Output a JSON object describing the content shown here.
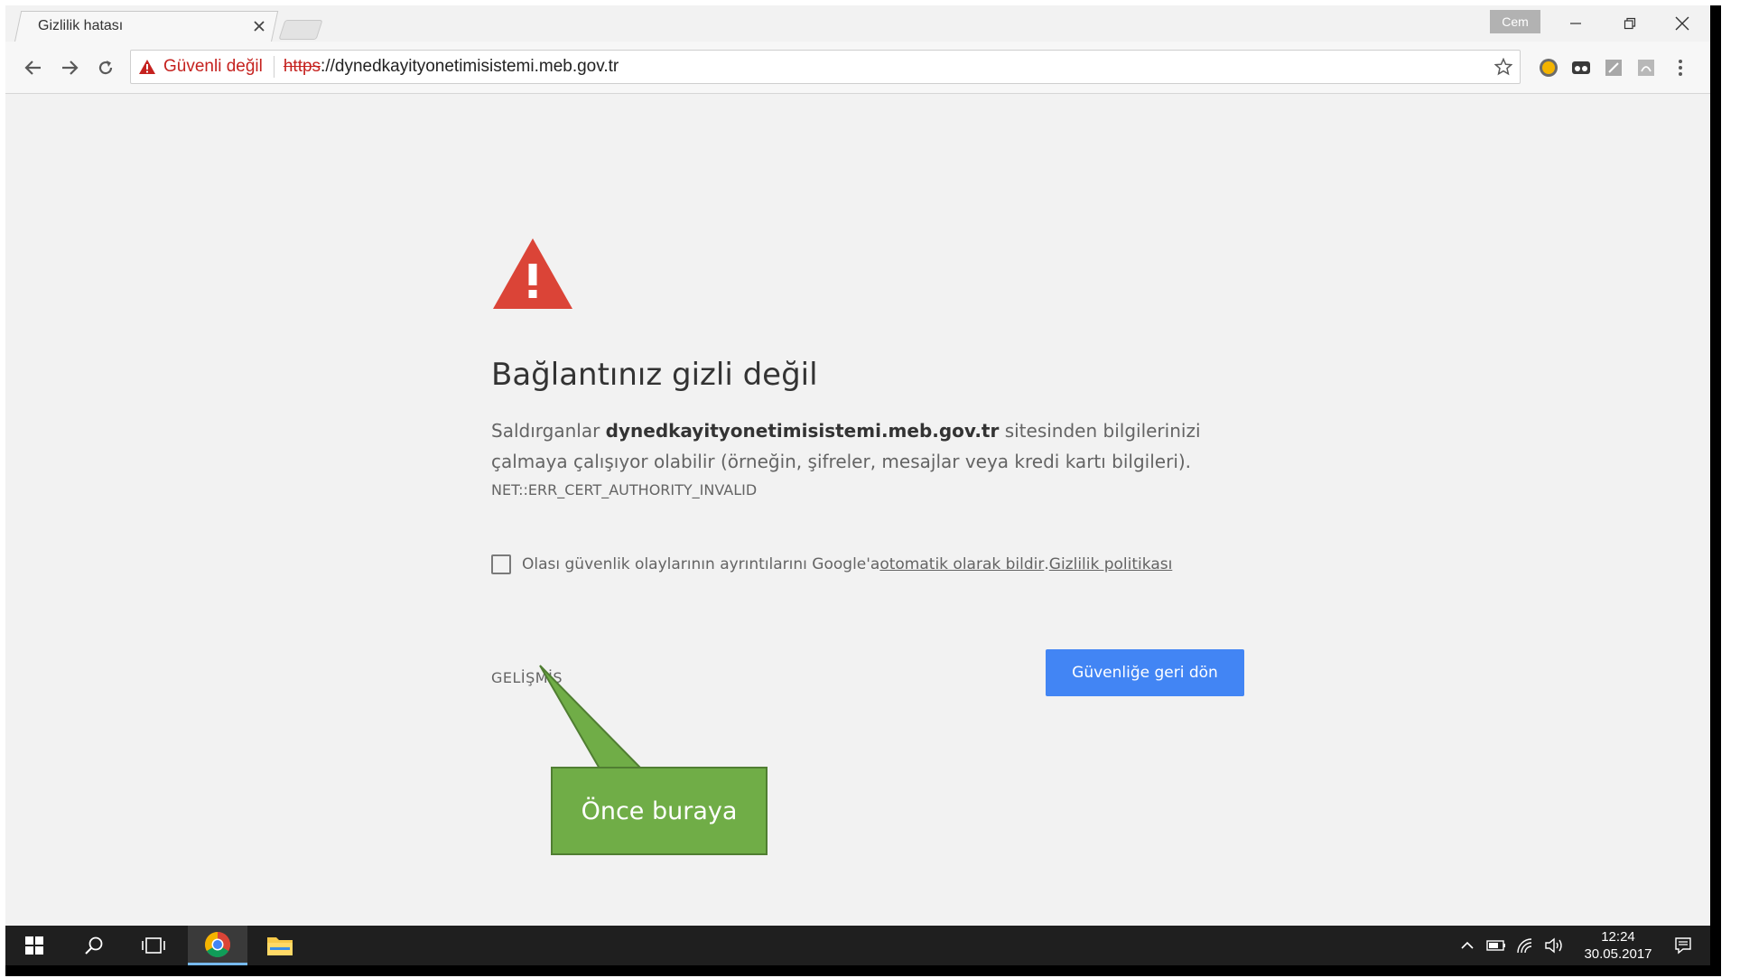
{
  "browser": {
    "tab_title": "Gizlilik hatası",
    "profile_name": "Cem",
    "security_label": "Güvenli değil",
    "url_scheme": "https",
    "url_rest": "://dynedkayityonetimisistemi.meb.gov.tr",
    "error_accent": "#c5221f"
  },
  "page": {
    "heading": "Bağlantınız gizli değil",
    "para_prefix": "Saldırganlar ",
    "para_host": "dynedkayityonetimisistemi.meb.gov.tr",
    "para_suffix": " sitesinden bilgilerinizi çalmaya çalışıyor olabilir (örneğin, şifreler, mesajlar veya kredi kartı bilgileri).",
    "error_code": "NET::ERR_CERT_AUTHORITY_INVALID",
    "report_text": "Olası güvenlik olaylarının ayrıntılarını Google'a ",
    "report_link": "otomatik olarak bildir",
    "report_sep": ". ",
    "privacy_link": "Gizlilik politikası",
    "advanced_label": "GELİŞMİŞ",
    "back_button": "Güvenliğe geri dön",
    "button_color": "#4285f4",
    "warning_color": "#db4437"
  },
  "callout": {
    "text": "Önce buraya",
    "color": "#70ad47"
  },
  "taskbar": {
    "time": "12:24",
    "date": "30.05.2017"
  }
}
